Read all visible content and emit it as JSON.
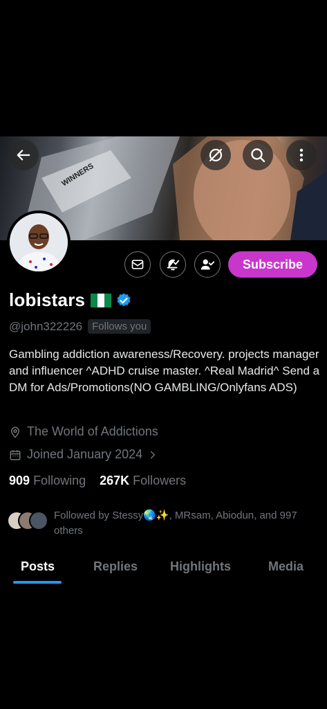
{
  "header": {
    "back_icon": "arrow-left-icon",
    "grok_icon": "grok-icon",
    "search_icon": "search-icon",
    "more_icon": "more-vertical-icon",
    "banner_text": "WINNERS"
  },
  "actions": {
    "message_icon": "envelope-icon",
    "notify_icon": "bell-check-icon",
    "following_icon": "person-check-icon",
    "subscribe_label": "Subscribe"
  },
  "profile": {
    "name": "lobistars",
    "flag": "nigeria-flag",
    "verified_icon": "verified-badge-icon",
    "handle": "@john322226",
    "follows_you": "Follows you",
    "bio": "Gambling addiction awareness/Recovery. projects manager and influencer ^ADHD cruise master. ^Real Madrid^ Send a DM for Ads/Promotions(NO GAMBLING/Onlyfans ADS)",
    "location": "The World of Addictions",
    "joined": "Joined January 2024"
  },
  "stats": {
    "following_count": "909",
    "following_label": "Following",
    "followers_count": "267K",
    "followers_label": "Followers"
  },
  "followed_by": "Followed by Stessy🌏✨, MRsam, Abiodun, and 997 others",
  "tabs": [
    "Posts",
    "Replies",
    "Highlights",
    "Media"
  ],
  "colors": {
    "accent": "#1d9bf0",
    "subscribe": "#c936cc",
    "muted": "#71767b"
  }
}
